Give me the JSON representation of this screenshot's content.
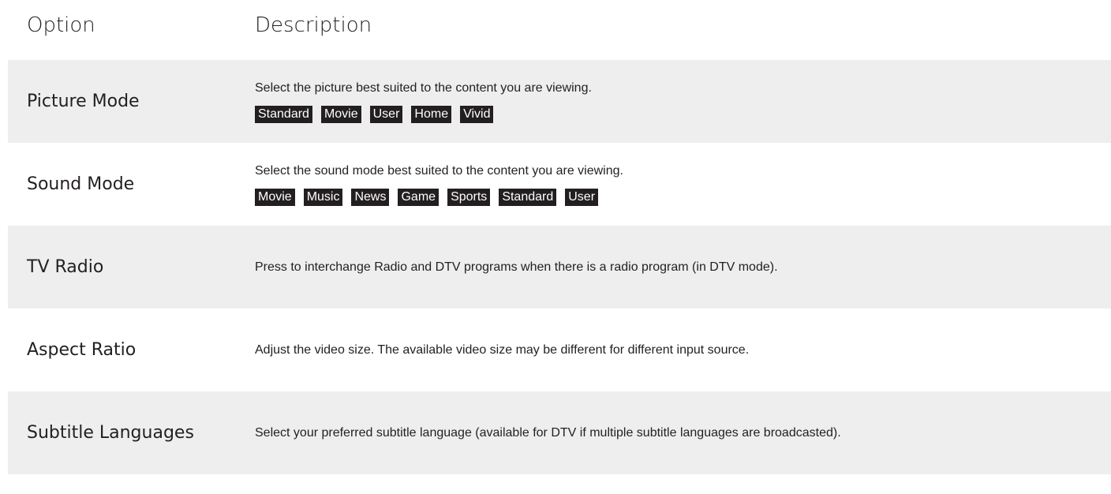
{
  "header": {
    "option": "Option",
    "description": "Description"
  },
  "rows": [
    {
      "option": "Picture Mode",
      "description": "Select the picture best suited to the content you are viewing.",
      "tags": [
        "Standard",
        "Movie",
        "User",
        "Home",
        "Vivid"
      ]
    },
    {
      "option": "Sound Mode",
      "description": "Select the sound mode best suited to the content you are viewing.",
      "tags": [
        "Movie",
        "Music",
        "News",
        "Game",
        "Sports",
        "Standard",
        "User"
      ]
    },
    {
      "option": "TV Radio",
      "description": "Press to interchange Radio and DTV programs when there is a radio program (in DTV mode).",
      "tags": []
    },
    {
      "option": "Aspect Ratio",
      "description": "Adjust the video size. The available video size may be different for different input source.",
      "tags": []
    },
    {
      "option": "Subtitle Languages",
      "description": "Select your preferred subtitle language (available for DTV if multiple subtitle languages are broadcasted).",
      "tags": []
    }
  ]
}
